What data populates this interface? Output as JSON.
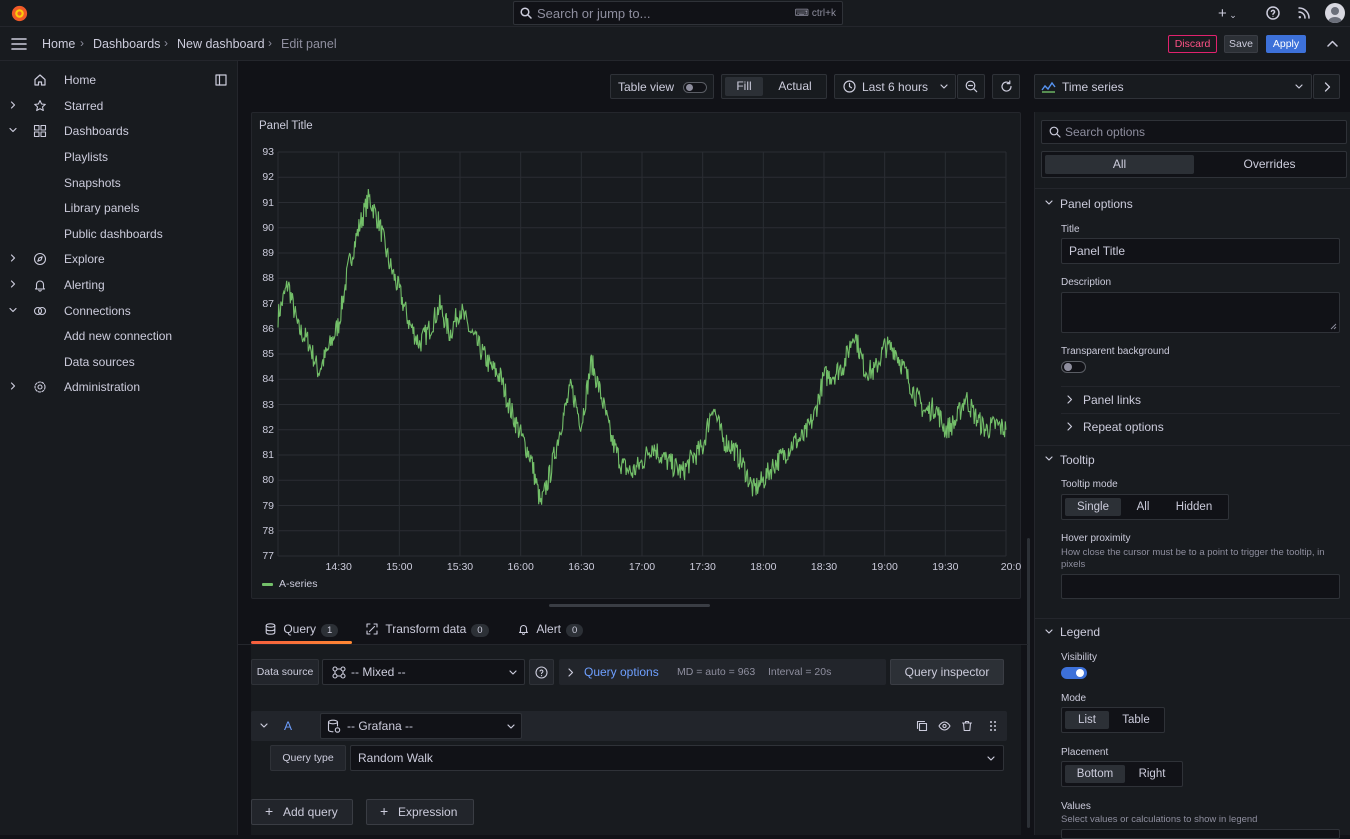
{
  "topbar": {
    "search_placeholder": "Search or jump to...",
    "search_shortcut": "ctrl+k",
    "plus_label": "+"
  },
  "breadcrumb": [
    "Home",
    "Dashboards",
    "New dashboard",
    "Edit panel"
  ],
  "actions": {
    "discard": "Discard",
    "save": "Save",
    "apply": "Apply"
  },
  "sidebar": {
    "items": [
      {
        "label": "Home",
        "icon": "home-icon"
      },
      {
        "label": "Starred",
        "icon": "star-icon"
      },
      {
        "label": "Dashboards",
        "icon": "apps-icon"
      },
      {
        "label": "Playlists"
      },
      {
        "label": "Snapshots"
      },
      {
        "label": "Library panels"
      },
      {
        "label": "Public dashboards"
      },
      {
        "label": "Explore",
        "icon": "compass-icon"
      },
      {
        "label": "Alerting",
        "icon": "bell-icon"
      },
      {
        "label": "Connections",
        "icon": "plug-icon"
      },
      {
        "label": "Add new connection"
      },
      {
        "label": "Data sources"
      },
      {
        "label": "Administration",
        "icon": "cog-icon"
      }
    ]
  },
  "toolbar": {
    "table_view": "Table view",
    "fill": "Fill",
    "actual": "Actual",
    "time_range": "Last 6 hours",
    "viz_type": "Time series"
  },
  "panel": {
    "title": "Panel Title",
    "legend": "A-series"
  },
  "chart_data": {
    "type": "line",
    "title": "Panel Title",
    "ylim": [
      77,
      93
    ],
    "yticks": [
      93,
      92,
      91,
      90,
      89,
      88,
      87,
      86,
      85,
      84,
      83,
      82,
      81,
      80,
      79,
      78,
      77
    ],
    "xticks": [
      "14:30",
      "15:00",
      "15:30",
      "16:00",
      "16:30",
      "17:00",
      "17:30",
      "18:00",
      "18:30",
      "19:00",
      "19:30",
      "20:0"
    ],
    "series": [
      {
        "name": "A-series",
        "color": "#73bf69",
        "x": [
          "14:00",
          "14:05",
          "14:10",
          "14:15",
          "14:20",
          "14:25",
          "14:30",
          "14:35",
          "14:40",
          "14:45",
          "14:50",
          "14:55",
          "15:00",
          "15:05",
          "15:10",
          "15:15",
          "15:20",
          "15:25",
          "15:30",
          "15:35",
          "15:40",
          "15:45",
          "15:50",
          "15:55",
          "16:00",
          "16:05",
          "16:10",
          "16:15",
          "16:20",
          "16:25",
          "16:30",
          "16:35",
          "16:40",
          "16:45",
          "16:50",
          "16:55",
          "17:00",
          "17:05",
          "17:10",
          "17:15",
          "17:20",
          "17:25",
          "17:30",
          "17:35",
          "17:40",
          "17:45",
          "17:50",
          "17:55",
          "18:00",
          "18:05",
          "18:10",
          "18:15",
          "18:20",
          "18:25",
          "18:30",
          "18:35",
          "18:40",
          "18:45",
          "18:50",
          "18:55",
          "19:00",
          "19:05",
          "19:10",
          "19:15",
          "19:20",
          "19:25",
          "19:30",
          "19:35",
          "19:40",
          "19:45",
          "19:50",
          "19:55",
          "20:00"
        ],
        "values": [
          86.5,
          87.8,
          86.0,
          85.5,
          84.3,
          85.2,
          86.2,
          88.5,
          90.0,
          91.2,
          90.2,
          88.6,
          87.5,
          86.2,
          85.4,
          86.0,
          86.9,
          85.8,
          86.8,
          85.9,
          85.2,
          84.5,
          84.1,
          82.8,
          81.8,
          80.9,
          79.0,
          80.4,
          82.2,
          83.7,
          82.2,
          84.7,
          83.3,
          81.6,
          80.6,
          80.3,
          80.7,
          81.4,
          80.9,
          80.6,
          80.3,
          80.9,
          81.3,
          83.0,
          81.6,
          81.3,
          80.6,
          79.6,
          80.0,
          80.6,
          81.0,
          81.5,
          81.7,
          82.5,
          84.1,
          84.2,
          84.6,
          85.9,
          84.4,
          84.3,
          85.3,
          85.2,
          84.3,
          83.4,
          82.7,
          82.9,
          82.0,
          82.3,
          83.3,
          82.5,
          82.0,
          82.2,
          82.0
        ]
      }
    ]
  },
  "query": {
    "tabs": [
      {
        "label": "Query",
        "count": "1"
      },
      {
        "label": "Transform data",
        "count": "0"
      },
      {
        "label": "Alert",
        "count": "0"
      }
    ],
    "datasource_label": "Data source",
    "datasource_value": "-- Mixed --",
    "query_options": "Query options",
    "md": "MD = auto = 963",
    "interval": "Interval = 20s",
    "inspector": "Query inspector",
    "row_letter": "A",
    "row_ds": "-- Grafana --",
    "query_type_label": "Query type",
    "query_type_value": "Random Walk",
    "add_query": "Add query",
    "expression": "Expression"
  },
  "options": {
    "search_placeholder": "Search options",
    "tabs": [
      "All",
      "Overrides"
    ],
    "panel_options": "Panel options",
    "title_label": "Title",
    "title_value": "Panel Title",
    "description_label": "Description",
    "transparent_label": "Transparent background",
    "panel_links": "Panel links",
    "repeat_options": "Repeat options",
    "tooltip": "Tooltip",
    "tooltip_mode_label": "Tooltip mode",
    "tooltip_modes": [
      "Single",
      "All",
      "Hidden"
    ],
    "hover_label": "Hover proximity",
    "hover_desc": "How close the cursor must be to a point to trigger the tooltip, in pixels",
    "legend": "Legend",
    "visibility_label": "Visibility",
    "mode_label": "Mode",
    "modes": [
      "List",
      "Table"
    ],
    "placement_label": "Placement",
    "placements": [
      "Bottom",
      "Right"
    ],
    "values_label": "Values",
    "values_desc": "Select values or calculations to show in legend"
  },
  "colors": {
    "accent": "#3d71d9",
    "series": "#73bf69",
    "discard": "#e0226e",
    "bg": "#111217",
    "panel": "#181b1f"
  }
}
